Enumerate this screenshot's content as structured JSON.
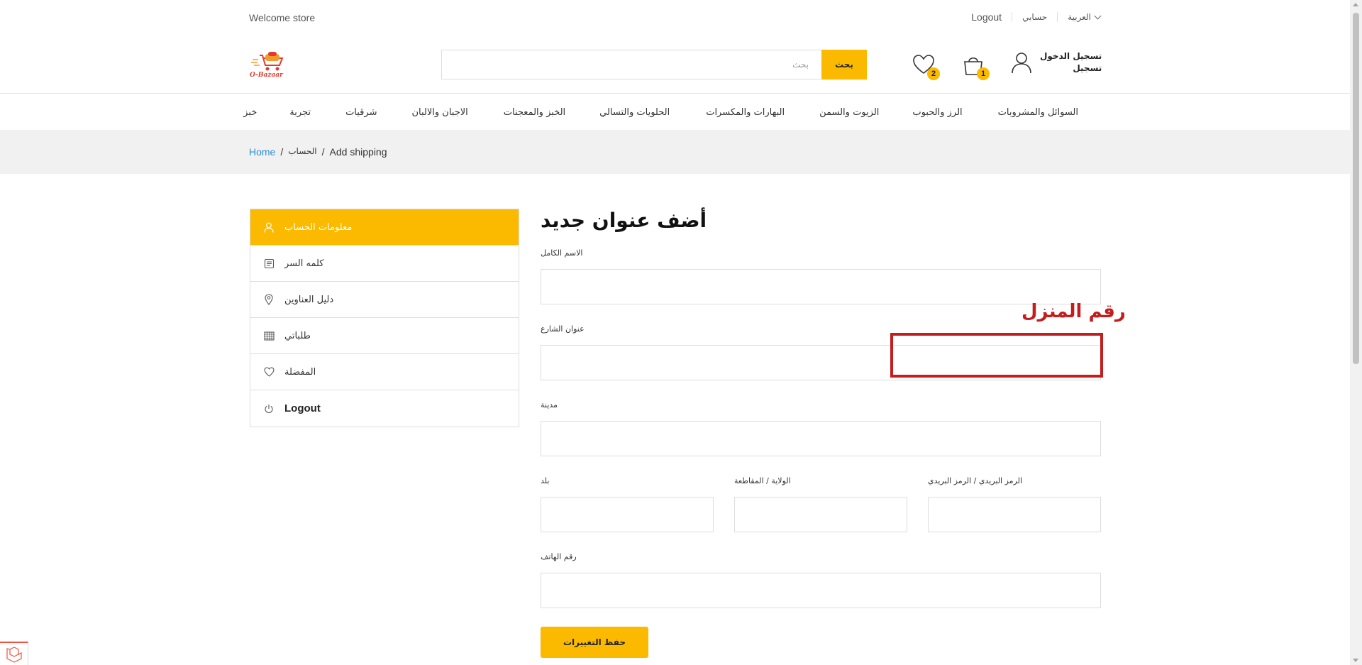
{
  "topbar": {
    "welcome": "Welcome store",
    "logout": "Logout",
    "my_account": "حسابي",
    "language": "العربية"
  },
  "header": {
    "logo_text": "O-Bazaar",
    "search_placeholder": "بحث",
    "search_button": "بحث",
    "wishlist_count": "2",
    "cart_count": "1",
    "login": "تسجيل الدخول",
    "register": "تسجيل"
  },
  "nav": {
    "items": [
      "السوائل والمشروبات",
      "الرز والحبوب",
      "الزيوت والسمن",
      "البهارات والمكسرات",
      "الحلويات والتسالي",
      "الخبز والمعجنات",
      "الاجبان والالبان",
      "شرقيات",
      "تجربة",
      "خبز"
    ]
  },
  "breadcrumb": {
    "home": "Home",
    "sep": "/",
    "account": "الحساب",
    "current": "Add shipping"
  },
  "sidebar": {
    "items": [
      {
        "label": "معلومات الحساب",
        "icon": "user-icon"
      },
      {
        "label": "كلمه السر",
        "icon": "document-icon"
      },
      {
        "label": "دليل العناوين",
        "icon": "map-pin-icon"
      },
      {
        "label": "طلباتي",
        "icon": "calendar-icon"
      },
      {
        "label": "المفضلة",
        "icon": "heart-icon"
      },
      {
        "label": "Logout",
        "icon": "power-icon"
      }
    ]
  },
  "form": {
    "title": "أضف عنوان جديد",
    "full_name_label": "الاسم الكامل",
    "street_label": "عنوان الشارع",
    "city_label": "مدينة",
    "country_label": "بلد",
    "state_label": "الولاية / المقاطعة",
    "zip_label": "الرمز البريدي / الرمز البريدي",
    "phone_label": "رقم الهاتف",
    "save_button": "حفظ التغييرات"
  },
  "annotation": {
    "text": "رقم المنزل",
    "color": "#c41d1d"
  },
  "colors": {
    "accent": "#fbb900",
    "link": "#2a8fd6"
  }
}
